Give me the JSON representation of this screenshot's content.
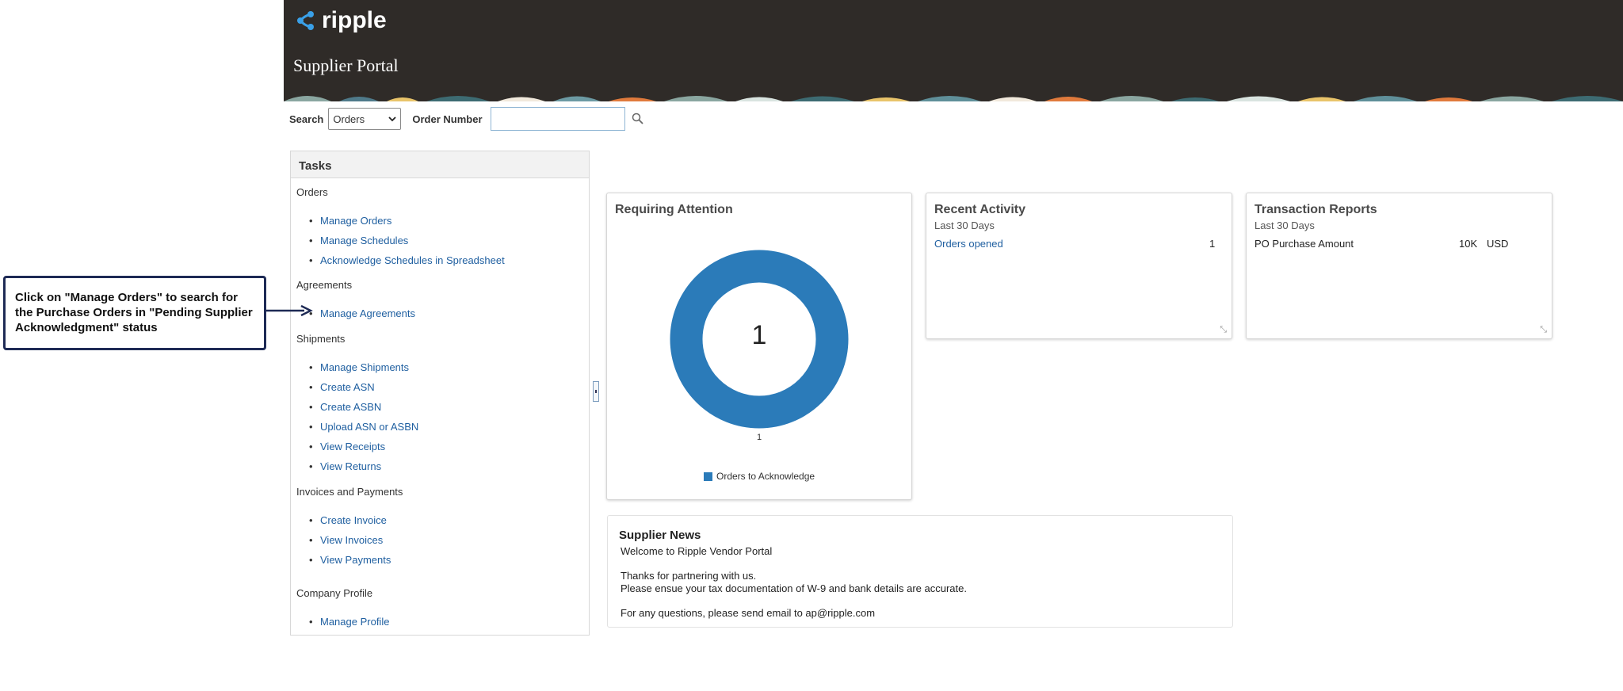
{
  "header": {
    "brand": "ripple",
    "portal_title": "Supplier Portal"
  },
  "search": {
    "label": "Search",
    "selected": "Orders",
    "order_number_label": "Order Number",
    "order_number_value": ""
  },
  "tasks": {
    "title": "Tasks",
    "sections": [
      {
        "title": "Orders",
        "items": [
          "Manage Orders",
          "Manage Schedules",
          "Acknowledge Schedules in Spreadsheet"
        ]
      },
      {
        "title": "Agreements",
        "items": [
          "Manage Agreements"
        ]
      },
      {
        "title": "Shipments",
        "items": [
          "Manage Shipments",
          "Create ASN",
          "Create ASBN",
          "Upload ASN or ASBN",
          "View Receipts",
          "View Returns"
        ]
      },
      {
        "title": "Invoices and Payments",
        "items": [
          "Create Invoice",
          "View Invoices",
          "View Payments"
        ]
      },
      {
        "title": "Company Profile",
        "items": [
          "Manage Profile"
        ]
      }
    ]
  },
  "callout": {
    "text": "Click on \"Manage Orders\" to search for the Purchase Orders in \"Pending Supplier Acknowledgment\" status"
  },
  "requiring_attention": {
    "title": "Requiring Attention",
    "center_value": "1",
    "axis_label": "1",
    "legend": "Orders to Acknowledge",
    "color": "#2b7bb9"
  },
  "recent_activity": {
    "title": "Recent Activity",
    "subtitle": "Last 30 Days",
    "row_label": "Orders opened",
    "row_value": "1"
  },
  "transaction_reports": {
    "title": "Transaction Reports",
    "subtitle": "Last 30 Days",
    "row_label": "PO Purchase Amount",
    "row_amount": "10K",
    "row_currency": "USD"
  },
  "supplier_news": {
    "title": "Supplier News",
    "welcome": "Welcome to Ripple Vendor Portal",
    "line1": "Thanks for partnering with us.",
    "line2": "Please ensue your tax documentation of W-9 and bank details are accurate.",
    "line3": "For any questions, please send email to ap@ripple.com"
  },
  "colors": {
    "header_bg": "#2f2b28",
    "link": "#1f5fa0",
    "chart": "#2b7bb9"
  }
}
